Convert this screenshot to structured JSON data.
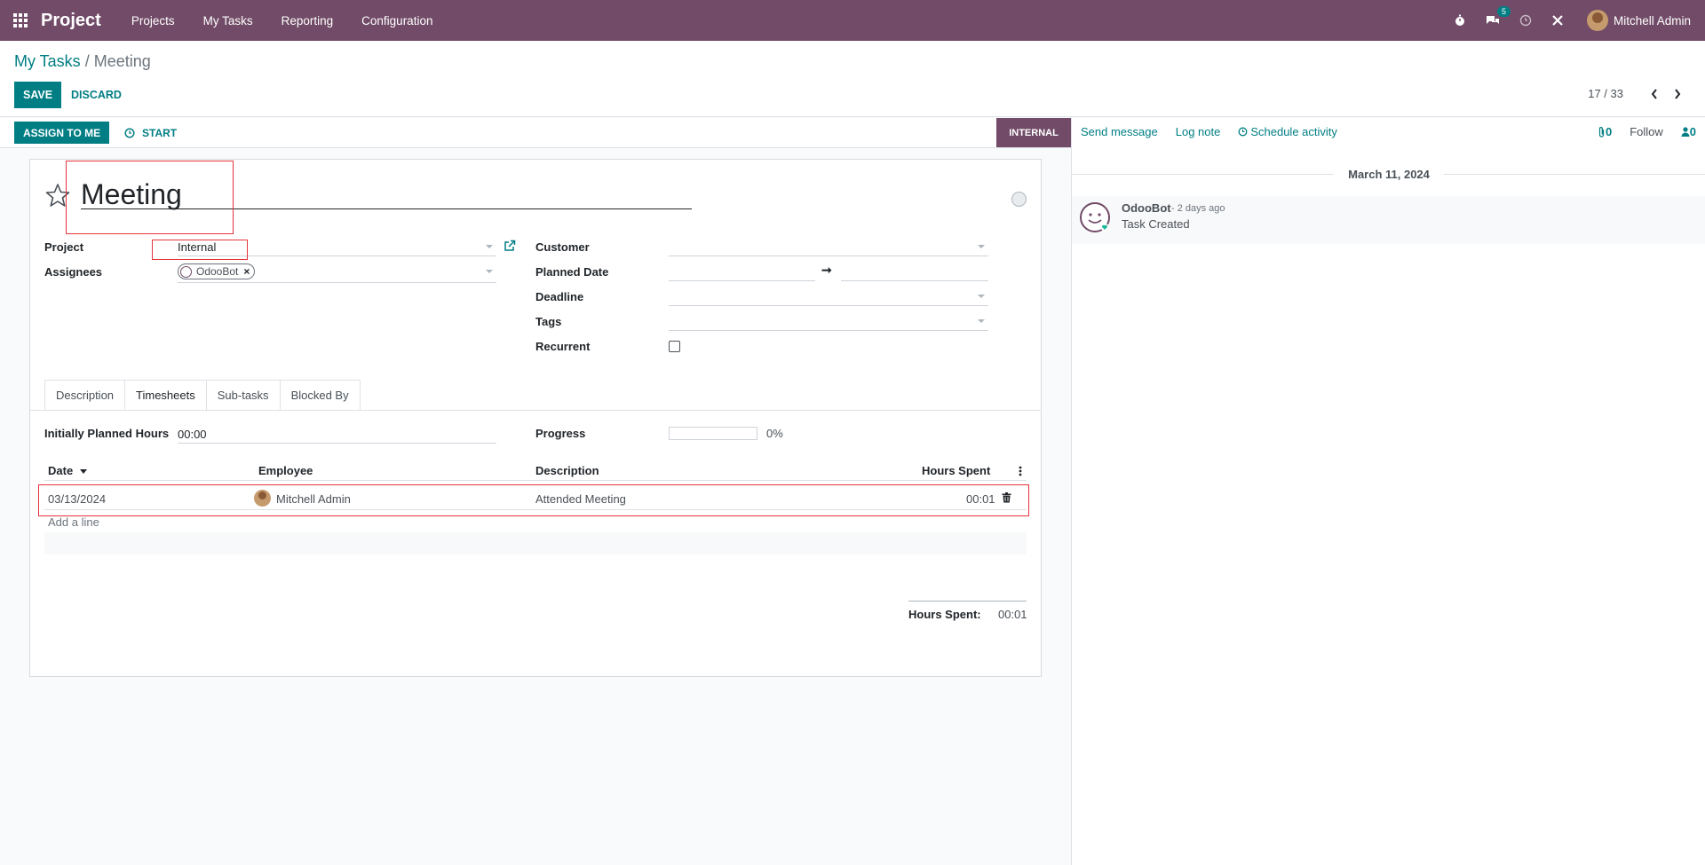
{
  "navbar": {
    "app_name": "Project",
    "menu": [
      "Projects",
      "My Tasks",
      "Reporting",
      "Configuration"
    ],
    "messages_badge": "5",
    "user_name": "Mitchell Admin"
  },
  "breadcrumb": {
    "parent": "My Tasks",
    "separator": "/",
    "current": "Meeting"
  },
  "actions": {
    "save": "SAVE",
    "discard": "DISCARD"
  },
  "pager": {
    "value": "17 / 33"
  },
  "statusbar": {
    "assign": "ASSIGN TO ME",
    "start": "START",
    "stage": "INTERNAL"
  },
  "task": {
    "title": "Meeting",
    "labels": {
      "project": "Project",
      "assignees": "Assignees",
      "customer": "Customer",
      "planned_date": "Planned Date",
      "deadline": "Deadline",
      "tags": "Tags",
      "recurrent": "Recurrent"
    },
    "project": "Internal",
    "assignee": "OdooBot",
    "date_arrow": "➞"
  },
  "tabs": [
    "Description",
    "Timesheets",
    "Sub-tasks",
    "Blocked By"
  ],
  "timesheets": {
    "planned_label": "Initially Planned Hours",
    "planned_value": "00:00",
    "progress_label": "Progress",
    "progress_text": "0%",
    "progress_value": 0,
    "columns": {
      "date": "Date",
      "employee": "Employee",
      "description": "Description",
      "hours": "Hours Spent"
    },
    "rows": [
      {
        "date": "03/13/2024",
        "employee": "Mitchell Admin",
        "description": "Attended Meeting",
        "hours": "00:01"
      }
    ],
    "add_line": "Add a line",
    "total_label": "Hours Spent:",
    "total_value": "00:01"
  },
  "chatter": {
    "send_message": "Send message",
    "log_note": "Log note",
    "schedule_activity": "Schedule activity",
    "attachments": "0",
    "follow": "Follow",
    "followers": "0",
    "date_separator": "March 11, 2024",
    "messages": [
      {
        "author": "OdooBot",
        "time": "- 2 days ago",
        "body": "Task Created"
      }
    ]
  },
  "colors": {
    "brand": "#714b67",
    "primary": "#017e84",
    "highlight": "#e5343d"
  }
}
